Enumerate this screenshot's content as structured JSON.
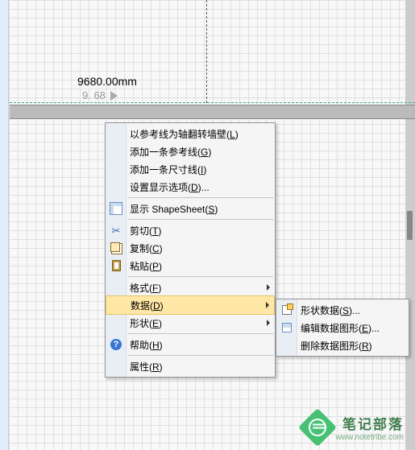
{
  "canvas": {
    "dimension_text": "9680.00mm",
    "coord_text": "9. 68"
  },
  "menu": {
    "mirror_wall": "以参考线为轴翻转墙壁(L)",
    "add_guide": "添加一条参考线(G)",
    "add_dim": "添加一条尺寸线(I)",
    "display_opts": "设置显示选项(D)...",
    "show_sheet": "显示 ShapeSheet(S)",
    "cut": "剪切(T)",
    "copy": "复制(C)",
    "paste": "粘贴(P)",
    "format": "格式(F)",
    "data": "数据(D)",
    "shape": "形状(E)",
    "help": "帮助(H)",
    "props": "属性(R)"
  },
  "submenu": {
    "shape_data": "形状数据(S)...",
    "edit_dg": "编辑数据图形(E)...",
    "delete_dg": "删除数据图形(R)"
  },
  "watermark": {
    "title": "笔记部落",
    "url": "www.notetribe.com"
  }
}
